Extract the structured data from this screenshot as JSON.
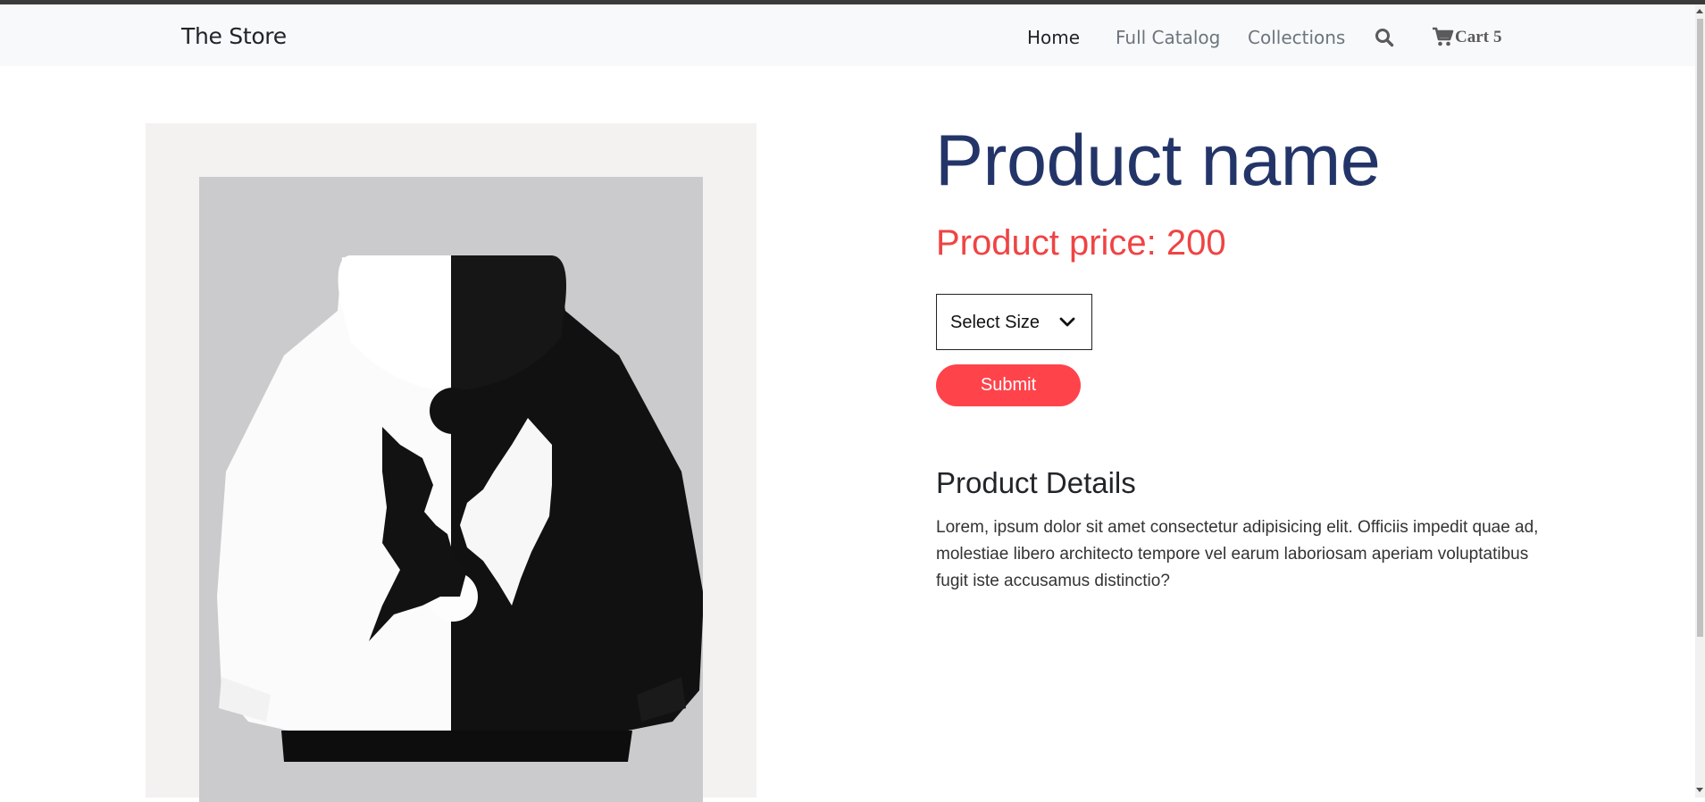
{
  "navbar": {
    "brand": "The Store",
    "links": [
      {
        "label": "Home",
        "active": true
      },
      {
        "label": "Full Catalog",
        "active": false
      },
      {
        "label": "Collections",
        "active": false
      }
    ],
    "search_icon": "search-icon",
    "cart": {
      "icon": "cart-icon",
      "label": "Cart",
      "count": "5"
    }
  },
  "product": {
    "name": "Product name",
    "price": "Product price: 200",
    "size_select": {
      "selected": "Select Size",
      "icon": "chevron-down-icon"
    },
    "submit_label": "Submit",
    "details_heading": "Product Details",
    "details_text": "Lorem, ipsum dolor sit amet consectetur adipisicing elit. Officiis impedit quae ad, molestiae libero architecto tempore vel earum laboriosam aperiam voluptatibus fugit iste accusamus distinctio?",
    "image_alt": "black and white yin-yang wolf hoodie"
  },
  "colors": {
    "title": "#233568",
    "price": "#ef4444",
    "button": "#ff434b",
    "navbar_bg": "#f8f9fa"
  }
}
